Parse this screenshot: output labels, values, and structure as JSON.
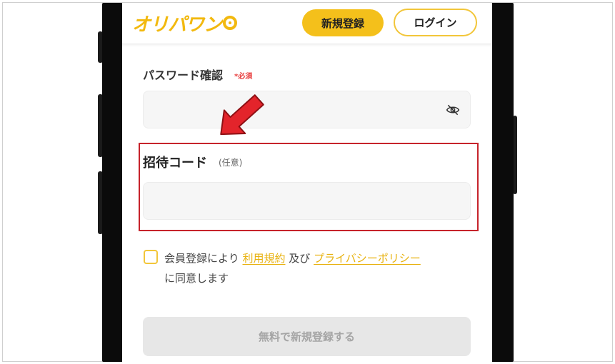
{
  "header": {
    "logo_text": "オリパワン",
    "register_label": "新規登録",
    "login_label": "ログイン"
  },
  "form": {
    "password_confirm_label": "パスワード確認",
    "required_badge": "*必須",
    "password_confirm_value": "",
    "invite_code_label": "招待コード",
    "optional_badge": "(任意)",
    "invite_code_value": ""
  },
  "agreement": {
    "prefix": "会員登録により",
    "terms_link": "利用規約",
    "conjunction": "及び",
    "privacy_link": "プライバシーポリシー",
    "suffix": "に同意します",
    "checked": false
  },
  "submit_label": "無料で新規登録する",
  "colors": {
    "brand_yellow": "#f4c01b",
    "required_red": "#e83b3b",
    "annotation_red": "#c6232b",
    "disabled_gray": "#e7e7e7"
  },
  "icons": {
    "password_toggle": "eye-off-icon",
    "annotation": "red-arrow-icon"
  }
}
